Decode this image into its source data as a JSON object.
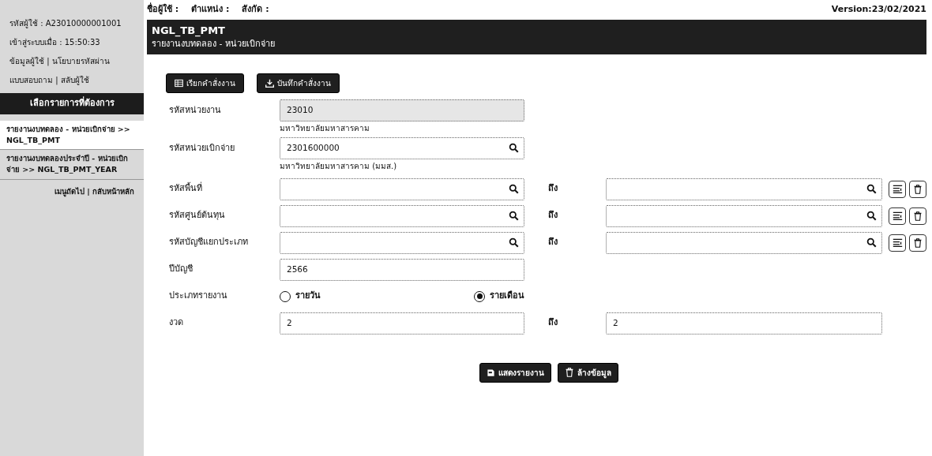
{
  "sidebar": {
    "info": [
      "รหัสผู้ใช้ : A23010000001001",
      "เข้าสู่ระบบเมื่อ : 15:50:33"
    ],
    "link_rows": [
      {
        "links": [
          "ข้อมูลผู้ใช้",
          "นโยบายรหัสผ่าน"
        ],
        "separator": "|"
      },
      {
        "links": [
          "แบบสอบถาม",
          "สลับผู้ใช้"
        ],
        "separator": "|"
      }
    ],
    "menu_title": "เลือกรายการที่ต้องการ",
    "menu_items": [
      {
        "label": "รายงานงบทดลอง - หน่วยเบิกจ่าย >> NGL_TB_PMT",
        "selected": true
      },
      {
        "label": "รายงานงบทดลองประจำปี - หน่วยเบิกจ่าย >> NGL_TB_PMT_YEAR",
        "selected": false
      }
    ],
    "nav_links": {
      "links": [
        "เมนูถัดไป",
        "กลับหน้าหลัก"
      ],
      "separator": "|"
    }
  },
  "top_bar": {
    "user_fields": [
      "ชื่อผู้ใช้ :",
      "ตำแหน่ง :",
      "สังกัด :"
    ],
    "version": "Version:23/02/2021"
  },
  "header": {
    "code": "NGL_TB_PMT",
    "title": "รายงานงบทดลอง - หน่วยเบิกจ่าย"
  },
  "toolbar": [
    {
      "kind": "load",
      "label": "เรียกคำสั่งงาน"
    },
    {
      "kind": "save",
      "label": "บันทึกคำสั่งงาน"
    }
  ],
  "form": [
    {
      "kind": "readonly",
      "label": "รหัสหน่วยงาน",
      "value": "23010",
      "description": "มหาวิทยาลัยมหาสารคาม"
    },
    {
      "kind": "lookup",
      "label": "รหัสหน่วยเบิกจ่าย",
      "value": "2301600000",
      "description": "มหาวิทยาลัยมหาสารคาม (มมส.)"
    },
    {
      "kind": "lookup_range",
      "label": "รหัสพื้นที่",
      "to_label": "ถึง"
    },
    {
      "kind": "lookup_range",
      "label": "รหัสศูนย์ต้นทุน",
      "to_label": "ถึง"
    },
    {
      "kind": "lookup_range",
      "label": "รหัสบัญชีแยกประเภท",
      "to_label": "ถึง"
    },
    {
      "kind": "text",
      "label": "ปีบัญชี",
      "value": "2566"
    },
    {
      "kind": "radio",
      "label": "ประเภทรายงาน",
      "options": [
        {
          "label": "รายวัน",
          "selected": false
        },
        {
          "label": "รายเดือน",
          "selected": true
        }
      ]
    },
    {
      "kind": "range",
      "label": "งวด",
      "value": "2",
      "to_label": "ถึง",
      "to_value": "2"
    }
  ],
  "actions": [
    {
      "kind": "report",
      "label": "แสดงรายงาน"
    },
    {
      "kind": "clear",
      "label": "ล้างข้อมูล"
    }
  ]
}
